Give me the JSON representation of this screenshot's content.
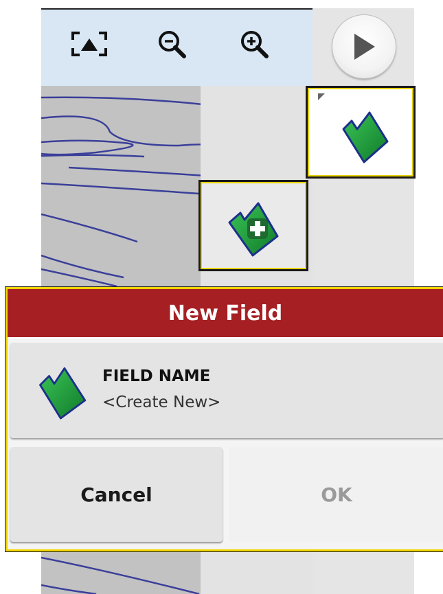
{
  "toolbar": {
    "icons": [
      "recenter-icon",
      "zoom-out-icon",
      "zoom-in-icon"
    ],
    "play_icon": "play-icon"
  },
  "tiles": {
    "field_icon": "field-icon",
    "add_field_icon": "add-field-icon"
  },
  "dialog": {
    "title": "New Field",
    "field_label": "FIELD NAME",
    "field_value": "<Create New>",
    "cancel_label": "Cancel",
    "ok_label": "OK",
    "ok_enabled": false
  },
  "colors": {
    "header_red": "#a51f23",
    "highlight_yellow": "#f2d600",
    "field_green": "#1f9e3a",
    "field_outline": "#1c2f8a",
    "toolbar_blue": "#d9e7f5",
    "map_line_blue": "#3a3f9a"
  }
}
